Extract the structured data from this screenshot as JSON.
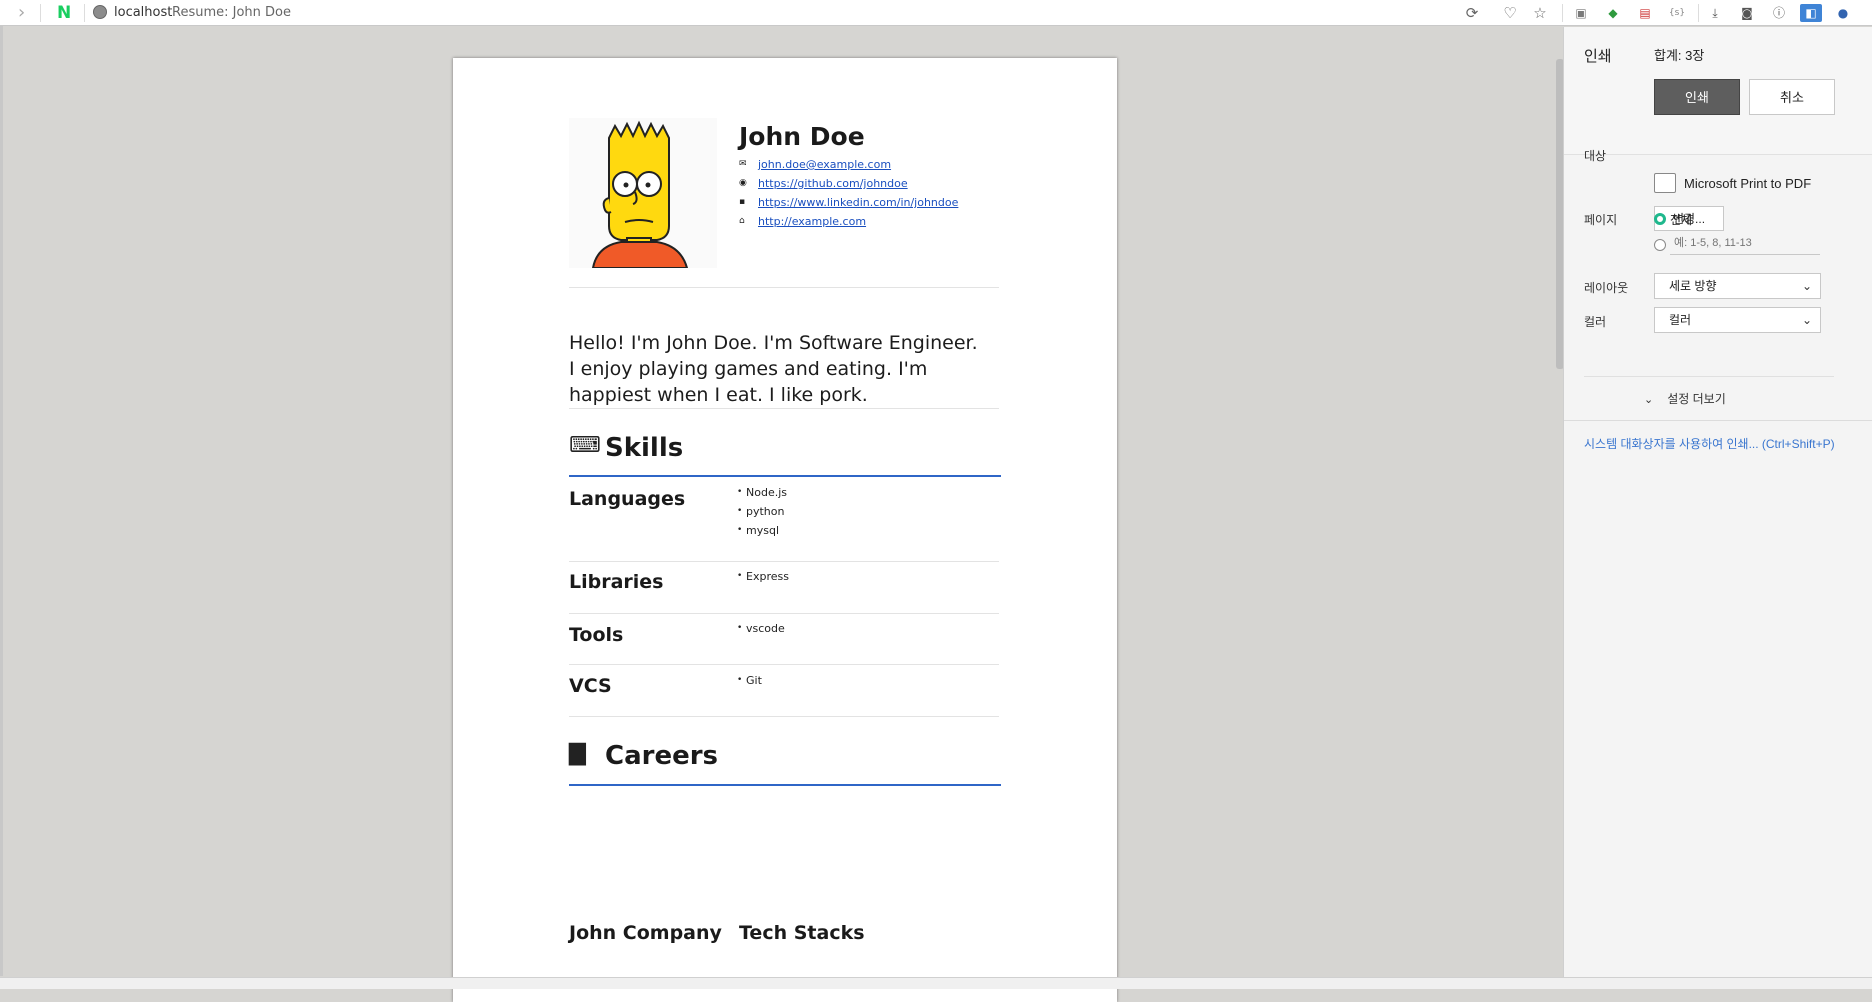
{
  "browser": {
    "host": "localhost",
    "page_title": "Resume: John Doe"
  },
  "resume": {
    "name": "John Doe",
    "contacts": {
      "email": "john.doe@example.com",
      "github": "https://github.com/johndoe",
      "linkedin": "https://www.linkedin.com/in/johndoe",
      "homepage": "http://example.com"
    },
    "intro": "Hello! I'm John Doe. I'm Software Engineer. I enjoy playing games and eating. I'm happiest when I eat. I like pork.",
    "skills_title": "Skills",
    "skills": {
      "languages": {
        "label": "Languages",
        "items": [
          "Node.js",
          "python",
          "mysql"
        ]
      },
      "libraries": {
        "label": "Libraries",
        "items": [
          "Express"
        ]
      },
      "tools": {
        "label": "Tools",
        "items": [
          "vscode"
        ]
      },
      "vcs": {
        "label": "VCS",
        "items": [
          "Git"
        ]
      }
    },
    "careers_title": "Careers",
    "career": {
      "company": "John Company",
      "tech_stacks": "Tech Stacks"
    }
  },
  "print_dialog": {
    "title": "인쇄",
    "total": "합계: 3장",
    "print_button": "인쇄",
    "cancel_button": "취소",
    "destination_label": "대상",
    "printer_name": "Microsoft Print to PDF",
    "change_button": "변경...",
    "pages_label": "페이지",
    "pages_all": "전체",
    "pages_custom_placeholder": "예: 1-5, 8, 11-13",
    "layout_label": "레이아웃",
    "layout_value": "세로 방향",
    "color_label": "컬러",
    "color_value": "컬러",
    "more_settings": "설정 더보기",
    "system_dialog_link": "시스템 대화상자를 사용하여 인쇄... (Ctrl+Shift+P)"
  }
}
